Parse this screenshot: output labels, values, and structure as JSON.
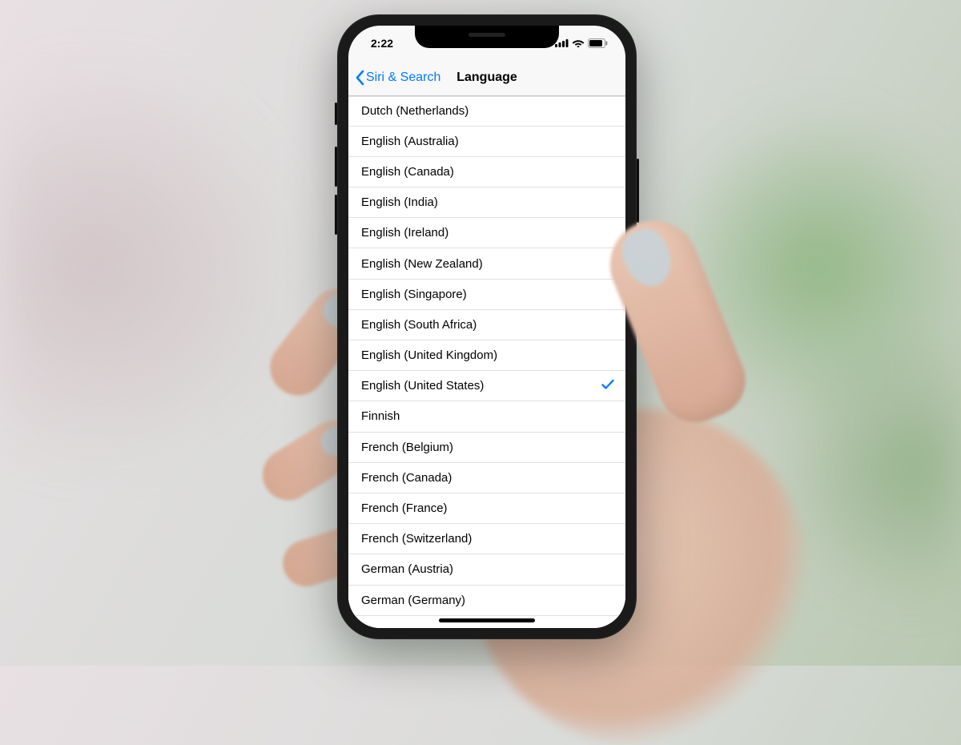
{
  "status": {
    "time": "2:22"
  },
  "nav": {
    "back_label": "Siri & Search",
    "title": "Language"
  },
  "languages": [
    {
      "label": "Dutch (Netherlands)",
      "selected": false
    },
    {
      "label": "English (Australia)",
      "selected": false
    },
    {
      "label": "English (Canada)",
      "selected": false
    },
    {
      "label": "English (India)",
      "selected": false
    },
    {
      "label": "English (Ireland)",
      "selected": false
    },
    {
      "label": "English (New Zealand)",
      "selected": false
    },
    {
      "label": "English (Singapore)",
      "selected": false
    },
    {
      "label": "English (South Africa)",
      "selected": false
    },
    {
      "label": "English (United Kingdom)",
      "selected": false
    },
    {
      "label": "English (United States)",
      "selected": true
    },
    {
      "label": "Finnish",
      "selected": false
    },
    {
      "label": "French (Belgium)",
      "selected": false
    },
    {
      "label": "French (Canada)",
      "selected": false
    },
    {
      "label": "French (France)",
      "selected": false
    },
    {
      "label": "French (Switzerland)",
      "selected": false
    },
    {
      "label": "German (Austria)",
      "selected": false
    },
    {
      "label": "German (Germany)",
      "selected": false
    }
  ]
}
